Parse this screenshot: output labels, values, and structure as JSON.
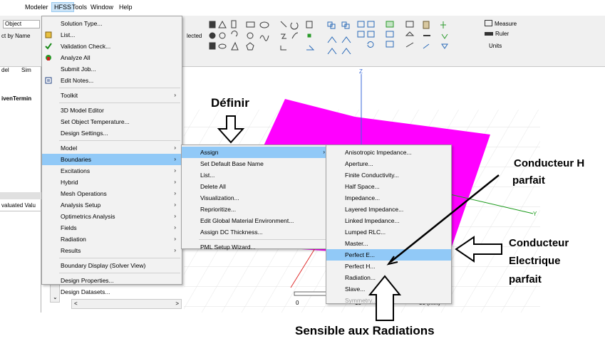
{
  "menubar": {
    "items": [
      "Modeler",
      "HFSS",
      "Tools",
      "Window",
      "Help"
    ]
  },
  "ribbon": {
    "object_field": "Object",
    "select_by_name": "ct by Name",
    "selected_label": "lected",
    "measure_label": "Measure",
    "ruler_label": "Ruler",
    "units_label": "Units"
  },
  "left_panel": {
    "tab_model": "del",
    "tab_sim": "Sim",
    "tree_item": "ivenTermin",
    "value_header": "valuated Valu"
  },
  "hfss_menu": {
    "items": [
      {
        "label": "Solution Type...",
        "icon": "none"
      },
      {
        "label": "List...",
        "icon": "list-icon"
      },
      {
        "label": "Validation Check...",
        "icon": "check-icon"
      },
      {
        "label": "Analyze All",
        "icon": "analyze-icon"
      },
      {
        "label": "Submit Job...",
        "icon": "none"
      },
      {
        "label": "Edit Notes...",
        "icon": "notes-icon"
      },
      {
        "label": "Toolkit",
        "submenu": true
      },
      {
        "label": "3D Model Editor"
      },
      {
        "label": "Set Object Temperature..."
      },
      {
        "label": "Design Settings..."
      },
      {
        "label": "Model",
        "submenu": true
      },
      {
        "label": "Boundaries",
        "submenu": true
      },
      {
        "label": "Excitations",
        "submenu": true
      },
      {
        "label": "Hybrid",
        "submenu": true
      },
      {
        "label": "Mesh Operations",
        "submenu": true
      },
      {
        "label": "Analysis Setup",
        "submenu": true
      },
      {
        "label": "Optimetrics Analysis",
        "submenu": true
      },
      {
        "label": "Fields",
        "submenu": true
      },
      {
        "label": "Radiation",
        "submenu": true
      },
      {
        "label": "Results",
        "submenu": true
      },
      {
        "label": "Boundary Display (Solver View)"
      },
      {
        "label": "Design Properties..."
      },
      {
        "label": "Design Datasets..."
      }
    ]
  },
  "boundaries_menu": {
    "items": [
      {
        "label": "Assign",
        "submenu": true
      },
      {
        "label": "Set Default Base Name"
      },
      {
        "label": "List..."
      },
      {
        "label": "Delete All"
      },
      {
        "label": "Visualization..."
      },
      {
        "label": "Reprioritize..."
      },
      {
        "label": "Edit Global Material Environment..."
      },
      {
        "label": "Assign DC Thickness..."
      },
      {
        "label": "PML Setup Wizard..."
      }
    ]
  },
  "assign_menu": {
    "items": [
      {
        "label": "Anisotropic Impedance..."
      },
      {
        "label": "Aperture..."
      },
      {
        "label": "Finite Conductivity..."
      },
      {
        "label": "Half Space..."
      },
      {
        "label": "Impedance..."
      },
      {
        "label": "Layered Impedance..."
      },
      {
        "label": "Linked Impedance..."
      },
      {
        "label": "Lumped RLC..."
      },
      {
        "label": "Master..."
      },
      {
        "label": "Perfect E..."
      },
      {
        "label": "Perfect H..."
      },
      {
        "label": "Radiation..."
      },
      {
        "label": "Slave..."
      },
      {
        "label": "Symmetry..."
      }
    ]
  },
  "canvas": {
    "axis_z": "Z",
    "axis_y": "Y",
    "scale_0": "0",
    "scale_15": "15",
    "scale_30": "30 (mm)",
    "box_color": "#ff00ff"
  },
  "annotations": {
    "definir": "Définir",
    "cond_h_line1": "Conducteur H",
    "cond_h_line2": "parfait",
    "cond_e_line1": "Conducteur",
    "cond_e_line2": "Electrique",
    "cond_e_line3": "parfait",
    "radiations": "Sensible aux Radiations"
  }
}
